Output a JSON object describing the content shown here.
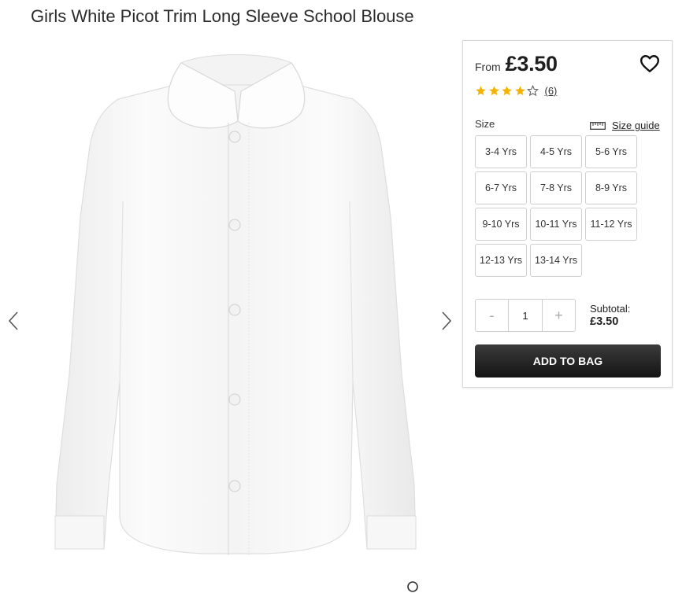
{
  "product": {
    "title": "Girls White Picot Trim Long Sleeve School Blouse"
  },
  "gallery": {
    "prev_icon": "chevron-left-icon",
    "next_icon": "chevron-right-icon",
    "image_alt": "white long sleeve school blouse"
  },
  "purchase": {
    "from_label": "From",
    "price": "£3.50",
    "wishlist_icon": "heart-icon",
    "rating": {
      "stars": 4,
      "max": 5,
      "reviews": "(6)",
      "star_color": "#f5b301"
    },
    "size_label": "Size",
    "size_guide_label": "Size guide",
    "size_guide_icon": "ruler-icon",
    "sizes": [
      "3-4 Yrs",
      "4-5 Yrs",
      "5-6 Yrs",
      "6-7 Yrs",
      "7-8 Yrs",
      "8-9 Yrs",
      "9-10 Yrs",
      "10-11 Yrs",
      "11-12 Yrs",
      "12-13 Yrs",
      "13-14 Yrs"
    ],
    "quantity": {
      "minus": "-",
      "value": "1",
      "plus": "+"
    },
    "subtotal_label": "Subtotal:",
    "subtotal_value": "£3.50",
    "add_to_bag": "ADD TO BAG"
  }
}
